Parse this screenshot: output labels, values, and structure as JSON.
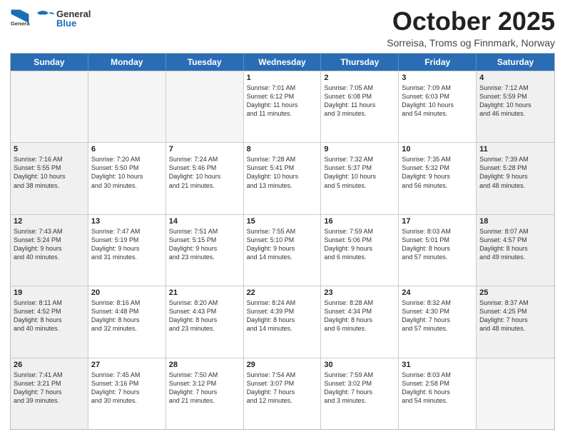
{
  "header": {
    "logo_general": "General",
    "logo_blue": "Blue",
    "month": "October 2025",
    "location": "Sorreisa, Troms og Finnmark, Norway"
  },
  "days": [
    "Sunday",
    "Monday",
    "Tuesday",
    "Wednesday",
    "Thursday",
    "Friday",
    "Saturday"
  ],
  "weeks": [
    [
      {
        "day": "",
        "text": ""
      },
      {
        "day": "",
        "text": ""
      },
      {
        "day": "",
        "text": ""
      },
      {
        "day": "1",
        "text": "Sunrise: 7:01 AM\nSunset: 6:12 PM\nDaylight: 11 hours\nand 11 minutes."
      },
      {
        "day": "2",
        "text": "Sunrise: 7:05 AM\nSunset: 6:08 PM\nDaylight: 11 hours\nand 3 minutes."
      },
      {
        "day": "3",
        "text": "Sunrise: 7:09 AM\nSunset: 6:03 PM\nDaylight: 10 hours\nand 54 minutes."
      },
      {
        "day": "4",
        "text": "Sunrise: 7:12 AM\nSunset: 5:59 PM\nDaylight: 10 hours\nand 46 minutes."
      }
    ],
    [
      {
        "day": "5",
        "text": "Sunrise: 7:16 AM\nSunset: 5:55 PM\nDaylight: 10 hours\nand 38 minutes."
      },
      {
        "day": "6",
        "text": "Sunrise: 7:20 AM\nSunset: 5:50 PM\nDaylight: 10 hours\nand 30 minutes."
      },
      {
        "day": "7",
        "text": "Sunrise: 7:24 AM\nSunset: 5:46 PM\nDaylight: 10 hours\nand 21 minutes."
      },
      {
        "day": "8",
        "text": "Sunrise: 7:28 AM\nSunset: 5:41 PM\nDaylight: 10 hours\nand 13 minutes."
      },
      {
        "day": "9",
        "text": "Sunrise: 7:32 AM\nSunset: 5:37 PM\nDaylight: 10 hours\nand 5 minutes."
      },
      {
        "day": "10",
        "text": "Sunrise: 7:35 AM\nSunset: 5:32 PM\nDaylight: 9 hours\nand 56 minutes."
      },
      {
        "day": "11",
        "text": "Sunrise: 7:39 AM\nSunset: 5:28 PM\nDaylight: 9 hours\nand 48 minutes."
      }
    ],
    [
      {
        "day": "12",
        "text": "Sunrise: 7:43 AM\nSunset: 5:24 PM\nDaylight: 9 hours\nand 40 minutes."
      },
      {
        "day": "13",
        "text": "Sunrise: 7:47 AM\nSunset: 5:19 PM\nDaylight: 9 hours\nand 31 minutes."
      },
      {
        "day": "14",
        "text": "Sunrise: 7:51 AM\nSunset: 5:15 PM\nDaylight: 9 hours\nand 23 minutes."
      },
      {
        "day": "15",
        "text": "Sunrise: 7:55 AM\nSunset: 5:10 PM\nDaylight: 9 hours\nand 14 minutes."
      },
      {
        "day": "16",
        "text": "Sunrise: 7:59 AM\nSunset: 5:06 PM\nDaylight: 9 hours\nand 6 minutes."
      },
      {
        "day": "17",
        "text": "Sunrise: 8:03 AM\nSunset: 5:01 PM\nDaylight: 8 hours\nand 57 minutes."
      },
      {
        "day": "18",
        "text": "Sunrise: 8:07 AM\nSunset: 4:57 PM\nDaylight: 8 hours\nand 49 minutes."
      }
    ],
    [
      {
        "day": "19",
        "text": "Sunrise: 8:11 AM\nSunset: 4:52 PM\nDaylight: 8 hours\nand 40 minutes."
      },
      {
        "day": "20",
        "text": "Sunrise: 8:16 AM\nSunset: 4:48 PM\nDaylight: 8 hours\nand 32 minutes."
      },
      {
        "day": "21",
        "text": "Sunrise: 8:20 AM\nSunset: 4:43 PM\nDaylight: 8 hours\nand 23 minutes."
      },
      {
        "day": "22",
        "text": "Sunrise: 8:24 AM\nSunset: 4:39 PM\nDaylight: 8 hours\nand 14 minutes."
      },
      {
        "day": "23",
        "text": "Sunrise: 8:28 AM\nSunset: 4:34 PM\nDaylight: 8 hours\nand 6 minutes."
      },
      {
        "day": "24",
        "text": "Sunrise: 8:32 AM\nSunset: 4:30 PM\nDaylight: 7 hours\nand 57 minutes."
      },
      {
        "day": "25",
        "text": "Sunrise: 8:37 AM\nSunset: 4:25 PM\nDaylight: 7 hours\nand 48 minutes."
      }
    ],
    [
      {
        "day": "26",
        "text": "Sunrise: 7:41 AM\nSunset: 3:21 PM\nDaylight: 7 hours\nand 39 minutes."
      },
      {
        "day": "27",
        "text": "Sunrise: 7:45 AM\nSunset: 3:16 PM\nDaylight: 7 hours\nand 30 minutes."
      },
      {
        "day": "28",
        "text": "Sunrise: 7:50 AM\nSunset: 3:12 PM\nDaylight: 7 hours\nand 21 minutes."
      },
      {
        "day": "29",
        "text": "Sunrise: 7:54 AM\nSunset: 3:07 PM\nDaylight: 7 hours\nand 12 minutes."
      },
      {
        "day": "30",
        "text": "Sunrise: 7:59 AM\nSunset: 3:02 PM\nDaylight: 7 hours\nand 3 minutes."
      },
      {
        "day": "31",
        "text": "Sunrise: 8:03 AM\nSunset: 2:58 PM\nDaylight: 6 hours\nand 54 minutes."
      },
      {
        "day": "",
        "text": ""
      }
    ]
  ]
}
